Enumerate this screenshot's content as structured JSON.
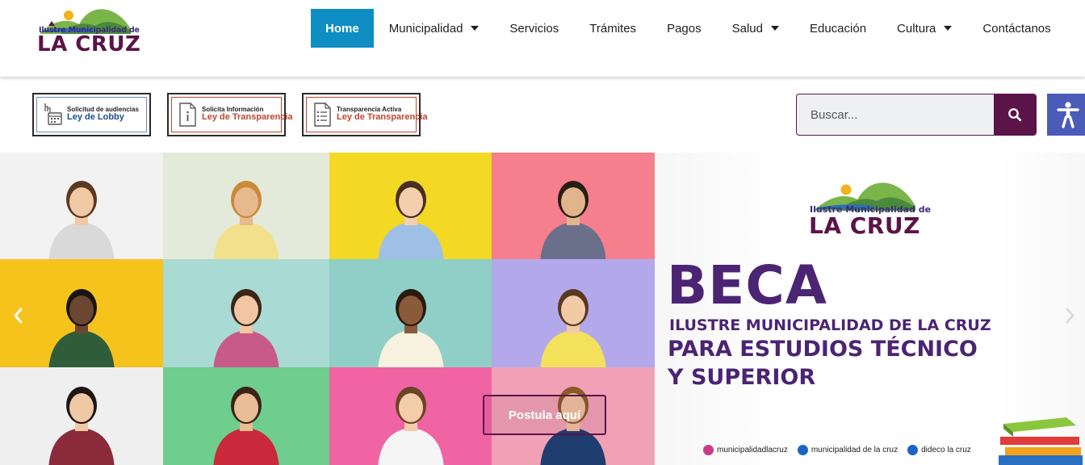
{
  "header": {
    "logo": {
      "script": "Ilustre Municipalidad de",
      "name": "LA CRUZ"
    },
    "nav": [
      {
        "label": "Home",
        "active": true,
        "dropdown": false
      },
      {
        "label": "Municipalidad",
        "active": false,
        "dropdown": true
      },
      {
        "label": "Servicios",
        "active": false,
        "dropdown": false
      },
      {
        "label": "Trámites",
        "active": false,
        "dropdown": false
      },
      {
        "label": "Pagos",
        "active": false,
        "dropdown": false
      },
      {
        "label": "Salud",
        "active": false,
        "dropdown": true
      },
      {
        "label": "Educación",
        "active": false,
        "dropdown": false
      },
      {
        "label": "Cultura",
        "active": false,
        "dropdown": true
      },
      {
        "label": "Contáctanos",
        "active": false,
        "dropdown": false
      }
    ]
  },
  "banners": [
    {
      "small": "Solicitud de audiencias",
      "big": "Ley de Lobby",
      "icon": "calendar-hand-icon"
    },
    {
      "small": "Solicita Información",
      "big": "Ley de Transparencia",
      "icon": "info-document-icon"
    },
    {
      "small": "Transparencia Activa",
      "big": "Ley de Transparencia",
      "icon": "list-document-icon"
    }
  ],
  "search": {
    "placeholder": "Buscar...",
    "icon": "search-icon"
  },
  "accessibility": {
    "icon": "accessibility-person-icon"
  },
  "slide": {
    "logo": {
      "script": "Ilustre Municipalidad de",
      "name": "LA CRUZ"
    },
    "title": "BECA",
    "subtitle1": "ILUSTRE MUNICIPALIDAD DE LA CRUZ",
    "subtitle2": "PARA ESTUDIOS TÉCNICO",
    "subtitle3": "Y SUPERIOR",
    "cta": "Postula aquí",
    "socials": [
      {
        "icon": "instagram-icon",
        "label": "municipalidadlacruz"
      },
      {
        "icon": "facebook-icon",
        "label": "municipalidad de la cruz"
      },
      {
        "icon": "facebook-icon",
        "label": "dideco la cruz"
      }
    ],
    "photo_backgrounds": [
      "#f2f2f2",
      "#e4ead9",
      "#f3d923",
      "#f57f8d",
      "#f6c21c",
      "#a9dad3",
      "#8fcfc7",
      "#b3a9ea",
      "#efefef",
      "#6fcd8d",
      "#f064a4",
      "#f0a1b5"
    ],
    "photo_clothes": [
      "#d9d9d9",
      "#f2e08a",
      "#9fc0e6",
      "#6a6f8a",
      "#2f5d3a",
      "#c85a8a",
      "#f7f1df",
      "#f3e15b",
      "#8a2a3b",
      "#c92a3b",
      "#f5f5f5",
      "#1f3d6e"
    ]
  },
  "colors": {
    "brand": "#5a1447",
    "accent": "#0e8ec2",
    "access": "#4a5bb8",
    "beca": "#4b2474"
  }
}
